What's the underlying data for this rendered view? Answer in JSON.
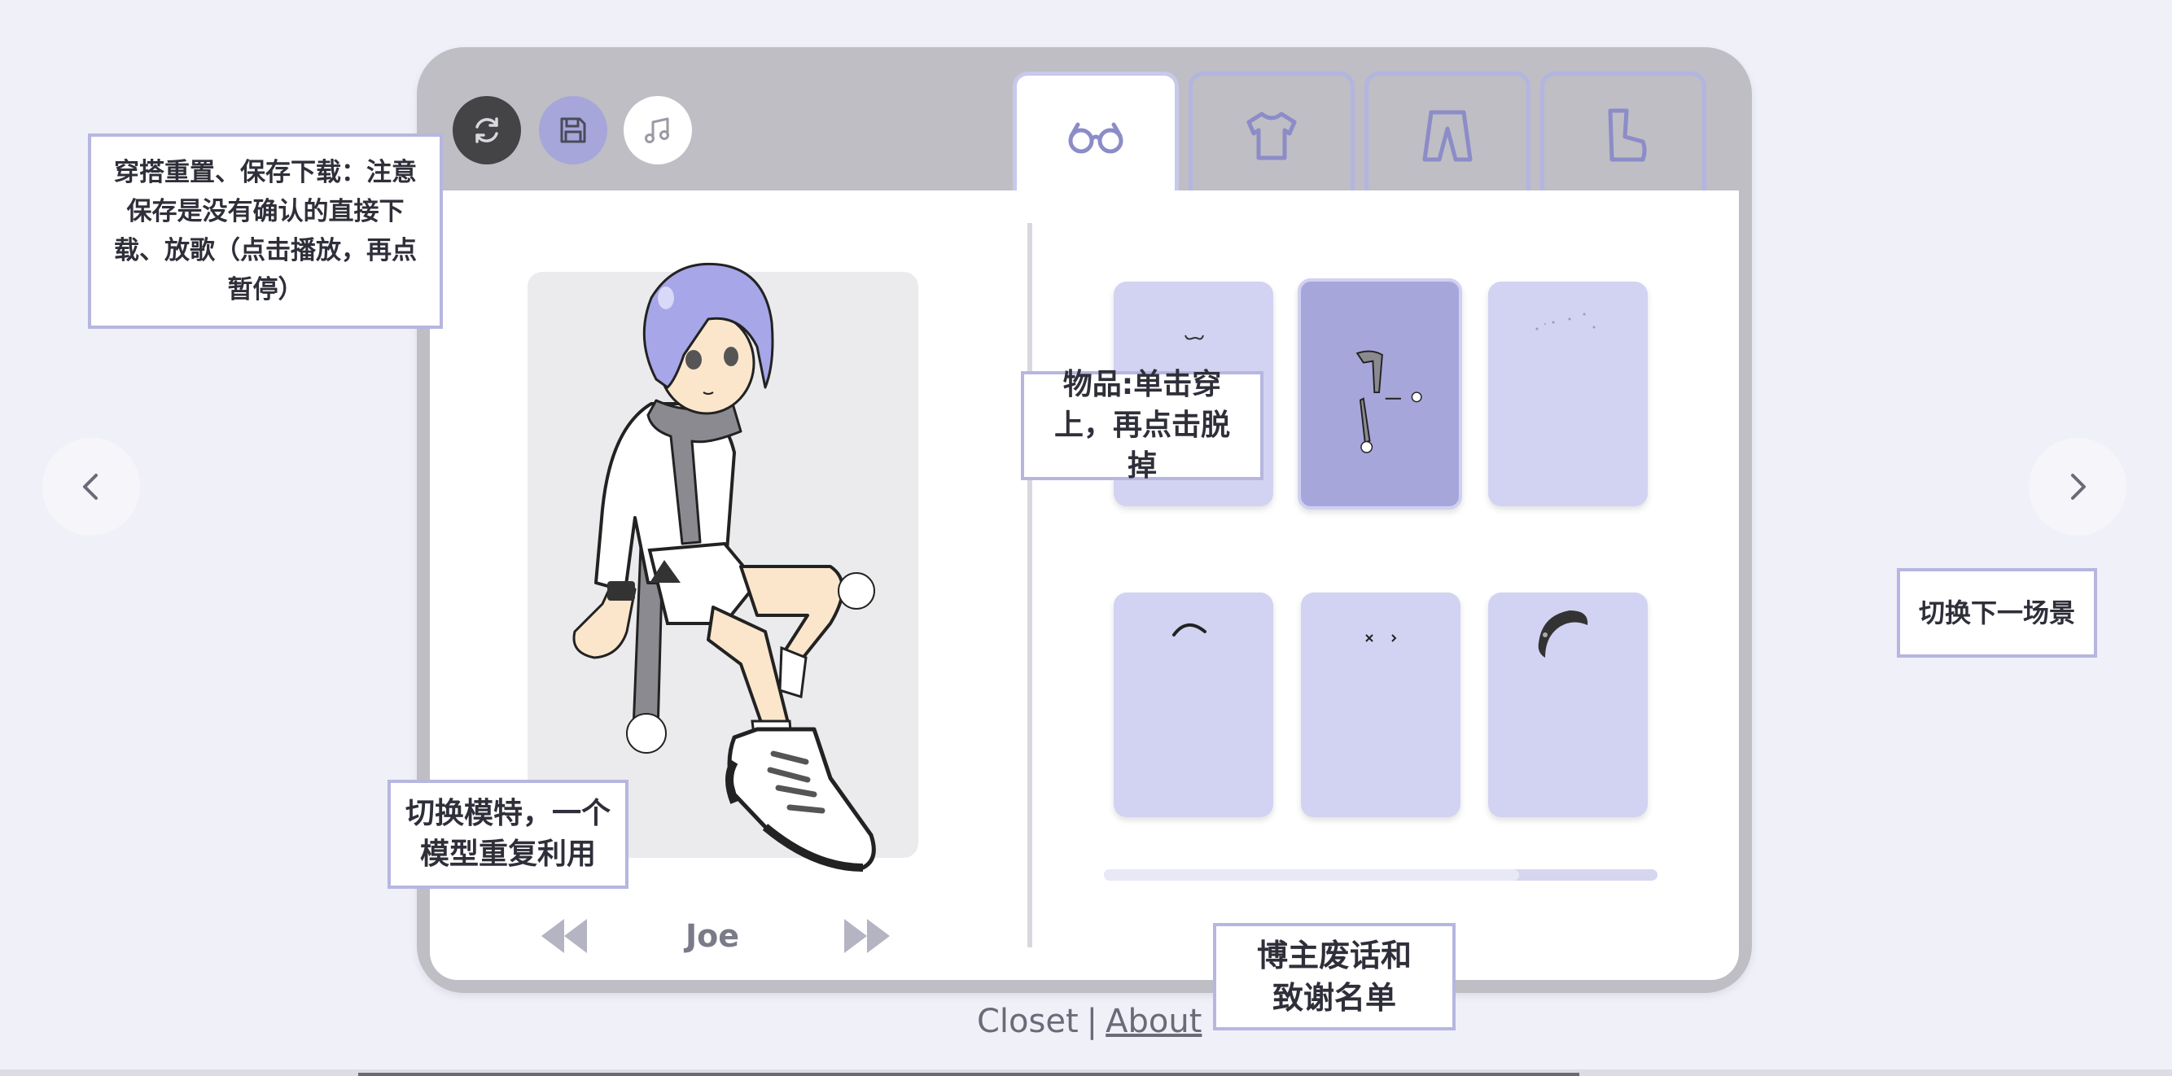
{
  "window": {
    "toolbar": [
      {
        "name": "reset-button",
        "icon": "refresh-icon"
      },
      {
        "name": "save-button",
        "icon": "floppy-disk-icon"
      },
      {
        "name": "music-button",
        "icon": "music-note-icon"
      }
    ],
    "tabs": [
      {
        "name": "tab-accessories",
        "icon": "glasses-icon",
        "active": true
      },
      {
        "name": "tab-tops",
        "icon": "shirt-icon",
        "active": false
      },
      {
        "name": "tab-bottoms",
        "icon": "pants-icon",
        "active": false
      },
      {
        "name": "tab-shoes",
        "icon": "boot-icon",
        "active": false
      }
    ]
  },
  "model": {
    "name": "Joe"
  },
  "items": [
    {
      "name": "item-mouth",
      "selected": false
    },
    {
      "name": "item-scarf",
      "selected": true
    },
    {
      "name": "item-sparkle",
      "selected": false
    },
    {
      "name": "item-eyebrow",
      "selected": false
    },
    {
      "name": "item-eyes",
      "selected": false
    },
    {
      "name": "item-hair",
      "selected": false
    }
  ],
  "notes": {
    "toolbar": "穿搭重置、保存下载：注意保存是没有确认的直接下载、放歌（点击播放，再点暂停）",
    "items": "物品:单击穿上，再点击脱掉",
    "model": "切换模特，一个模型重复利用",
    "next_scene": "切换下一场景",
    "about": "博主废话和致谢名单"
  },
  "footer": {
    "closet": "Closet",
    "separator": "|",
    "about": "About"
  },
  "colors": {
    "accent": "#a6a6da",
    "window": "#bebec4",
    "background": "#f0f0f9"
  }
}
